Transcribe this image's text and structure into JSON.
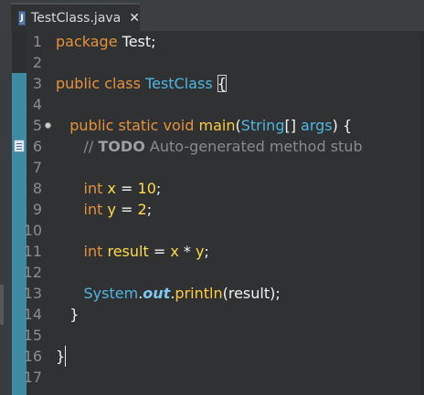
{
  "tab": {
    "title": "TestClass.java",
    "icon": "java-file-icon",
    "icon_letter": "J",
    "close_glyph": "✕"
  },
  "lines": [
    {
      "n": "1",
      "text": "package Test;"
    },
    {
      "n": "2",
      "text": ""
    },
    {
      "n": "3",
      "text": "public class TestClass {"
    },
    {
      "n": "4",
      "text": ""
    },
    {
      "n": "5",
      "text": "   public static void main(String[] args) {"
    },
    {
      "n": "6",
      "text": "      // TODO Auto-generated method stub"
    },
    {
      "n": "7",
      "text": ""
    },
    {
      "n": "8",
      "text": "      int x = 10;"
    },
    {
      "n": "9",
      "text": "      int y = 2;"
    },
    {
      "n": "10",
      "text": ""
    },
    {
      "n": "11",
      "text": "      int result = x * y;"
    },
    {
      "n": "12",
      "text": ""
    },
    {
      "n": "13",
      "text": "      System.out.println(result);"
    },
    {
      "n": "14",
      "text": "   }"
    },
    {
      "n": "15",
      "text": ""
    },
    {
      "n": "16",
      "text": "}"
    },
    {
      "n": "17",
      "text": ""
    }
  ],
  "colors": {
    "background": "#2f3133",
    "keyword": "#e6923c",
    "type": "#4fb6e0",
    "method": "#ffcc3a",
    "variable": "#ffdd44",
    "comment": "#8a8a8a",
    "change_bar": "#3f8aa3",
    "line_number": "#8c8c8c"
  }
}
